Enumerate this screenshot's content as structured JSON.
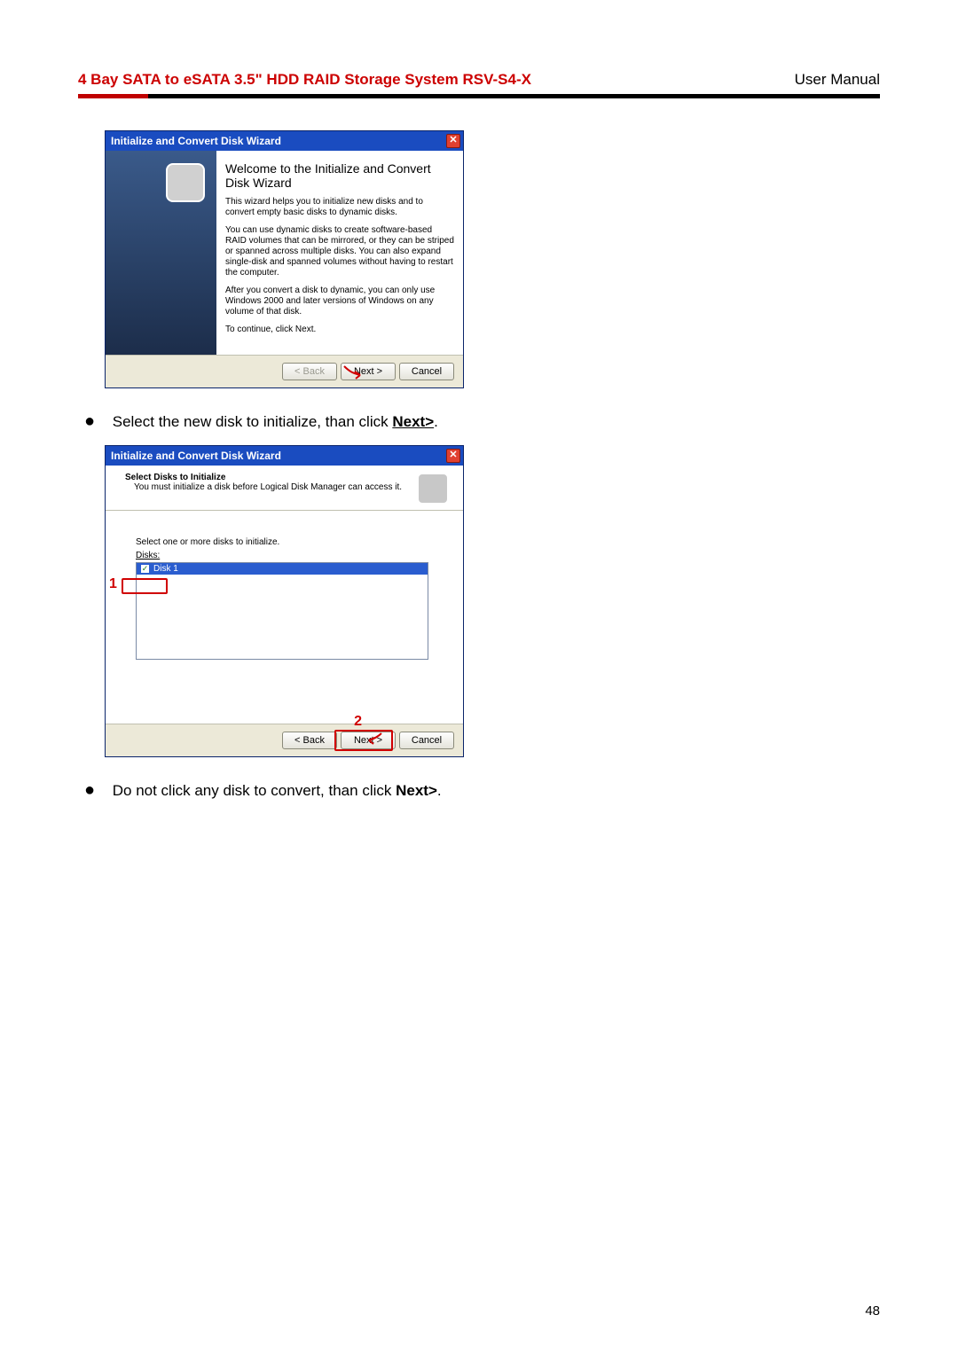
{
  "header": {
    "title_bold": "4 Bay SATA to eSATA 3.5\" HDD RAID Storage System",
    "model": " RSV-S4-X",
    "right": "User Manual"
  },
  "dialog1": {
    "title": "Initialize and Convert Disk Wizard",
    "heading": "Welcome to the Initialize and Convert Disk Wizard",
    "p1": "This wizard helps you to initialize new disks and to convert empty basic disks to dynamic disks.",
    "p2": "You can use dynamic disks to create software-based RAID volumes that can be mirrored, or they can be striped or spanned across multiple disks. You can also expand single-disk and spanned volumes without having to restart the computer.",
    "p3": "After you convert a disk to dynamic, you can only use Windows 2000 and later versions of Windows on any volume of that disk.",
    "p4": "To continue, click Next.",
    "buttons": {
      "back": "< Back",
      "next": "Next >",
      "cancel": "Cancel"
    }
  },
  "bullet1": {
    "text_a": "Select the new disk to initialize, than click ",
    "text_b": "Next>",
    "text_c": "."
  },
  "dialog2": {
    "title": "Initialize and Convert Disk Wizard",
    "subtitle": "Select Disks to Initialize",
    "subdesc": "You must initialize a disk before Logical Disk Manager can access it.",
    "instruction": "Select one or more disks to initialize.",
    "disks_label": "Disks:",
    "disk_item": "Disk 1",
    "annot1": "1",
    "annot2": "2",
    "buttons": {
      "back": "< Back",
      "next": "Next >",
      "cancel": "Cancel"
    }
  },
  "bullet2": {
    "text_a": "Do not click any disk to convert, than click ",
    "text_b": "Next>",
    "text_c": "."
  },
  "page_number": "48"
}
